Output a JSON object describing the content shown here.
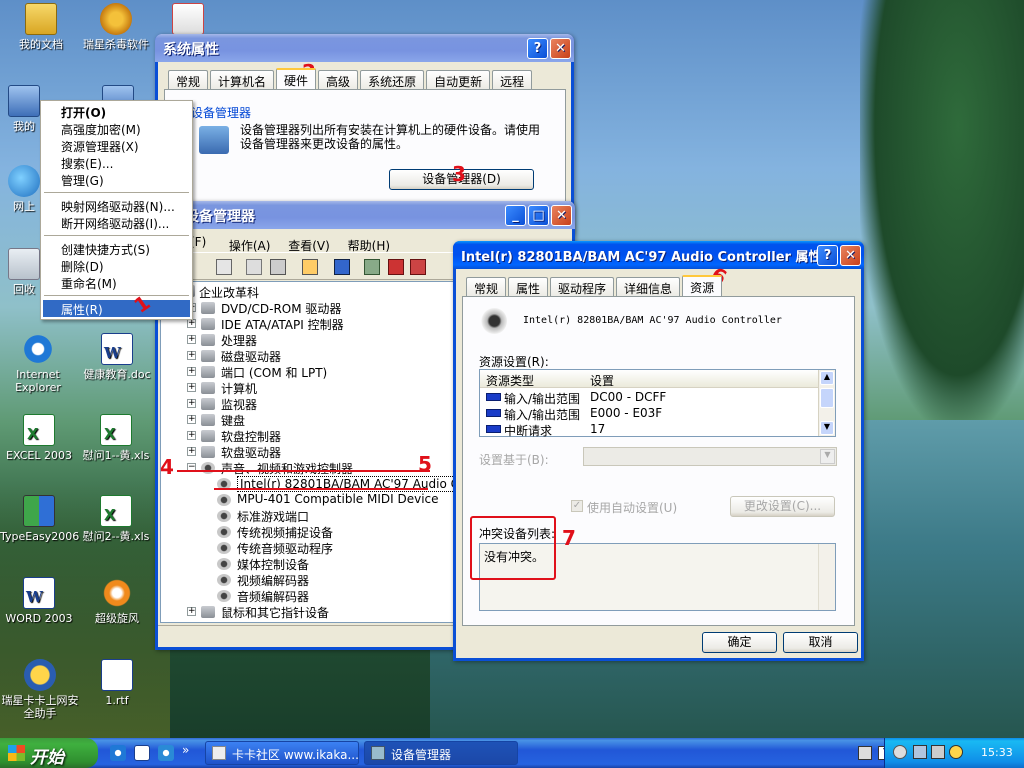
{
  "desktop": {
    "icons": [
      {
        "label": "我的文档"
      },
      {
        "label": "瑞星杀毒软件"
      },
      {
        "label": "我的"
      },
      {
        "label": "网上"
      },
      {
        "label": "回收"
      },
      {
        "label": "Internet Explorer"
      },
      {
        "label": "健康教育.doc"
      },
      {
        "label": "EXCEL 2003"
      },
      {
        "label": "慰问1--黄.xls"
      },
      {
        "label": "TypeEasy2006"
      },
      {
        "label": "慰问2--黄.xls"
      },
      {
        "label": "WORD 2003"
      },
      {
        "label": "超级旋风"
      },
      {
        "label": "瑞星卡卡上网安全助手"
      },
      {
        "label": "1.rtf"
      }
    ]
  },
  "context_menu": {
    "items": [
      {
        "label": "打开(O)",
        "bold": true
      },
      {
        "label": "高强度加密(M)"
      },
      {
        "label": "资源管理器(X)"
      },
      {
        "label": "搜索(E)..."
      },
      {
        "label": "管理(G)"
      },
      {
        "label": "映射网络驱动器(N)..."
      },
      {
        "label": "断开网络驱动器(I)..."
      },
      {
        "label": "创建快捷方式(S)"
      },
      {
        "label": "删除(D)"
      },
      {
        "label": "重命名(M)"
      },
      {
        "label": "属性(R)",
        "selected": true
      }
    ]
  },
  "sysprops": {
    "title": "系统属性",
    "tabs": [
      "常规",
      "计算机名",
      "硬件",
      "高级",
      "系统还原",
      "自动更新",
      "远程"
    ],
    "group_title": "设备管理器",
    "description": "设备管理器列出所有安装在计算机上的硬件设备。请使用设备管理器来更改设备的属性。",
    "button": "设备管理器(D)"
  },
  "devmgr": {
    "title": "设备管理器",
    "menu": [
      "文件(F)",
      "操作(A)",
      "查看(V)",
      "帮助(H)"
    ],
    "root": "企业改革科",
    "nodes": [
      {
        "label": "DVD/CD-ROM 驱动器"
      },
      {
        "label": "IDE ATA/ATAPI 控制器"
      },
      {
        "label": "处理器"
      },
      {
        "label": "磁盘驱动器"
      },
      {
        "label": "端口 (COM 和 LPT)"
      },
      {
        "label": "计算机"
      },
      {
        "label": "监视器"
      },
      {
        "label": "键盘"
      },
      {
        "label": "软盘控制器"
      },
      {
        "label": "软盘驱动器"
      },
      {
        "label": "声音、视频和游戏控制器"
      },
      {
        "label": "Intel(r) 82801BA/BAM AC'97 Audio Controller"
      },
      {
        "label": "MPU-401 Compatible MIDI Device"
      },
      {
        "label": "标准游戏端口"
      },
      {
        "label": "传统视频捕捉设备"
      },
      {
        "label": "传统音频驱动程序"
      },
      {
        "label": "媒体控制设备"
      },
      {
        "label": "视频编解码器"
      },
      {
        "label": "音频编解码器"
      },
      {
        "label": "鼠标和其它指针设备"
      }
    ]
  },
  "audioprops": {
    "title": "Intel(r) 82801BA/BAM AC'97 Audio Controller 属性",
    "tabs": [
      "常规",
      "属性",
      "驱动程序",
      "详细信息",
      "资源"
    ],
    "device_name": "Intel(r) 82801BA/BAM AC'97 Audio Controller",
    "resources_label": "资源设置(R):",
    "col_type": "资源类型",
    "col_setting": "设置",
    "resources": [
      {
        "type": "输入/输出范围",
        "setting": "DC00 - DCFF"
      },
      {
        "type": "输入/输出范围",
        "setting": "E000 - E03F"
      },
      {
        "type": "中断请求",
        "setting": "17"
      }
    ],
    "setting_based_on": "设置基于(B):",
    "use_auto": "使用自动设置(U)",
    "change_setting": "更改设置(C)...",
    "conflict_label": "冲突设备列表:",
    "conflict_text": "没有冲突。",
    "ok": "确定",
    "cancel": "取消"
  },
  "annotations": [
    "1",
    "2",
    "3",
    "4",
    "5",
    "6",
    "7"
  ],
  "taskbar": {
    "start": "开始",
    "tasks": [
      "卡卡社区 www.ikaka....",
      "设备管理器"
    ],
    "time": "15:33"
  }
}
